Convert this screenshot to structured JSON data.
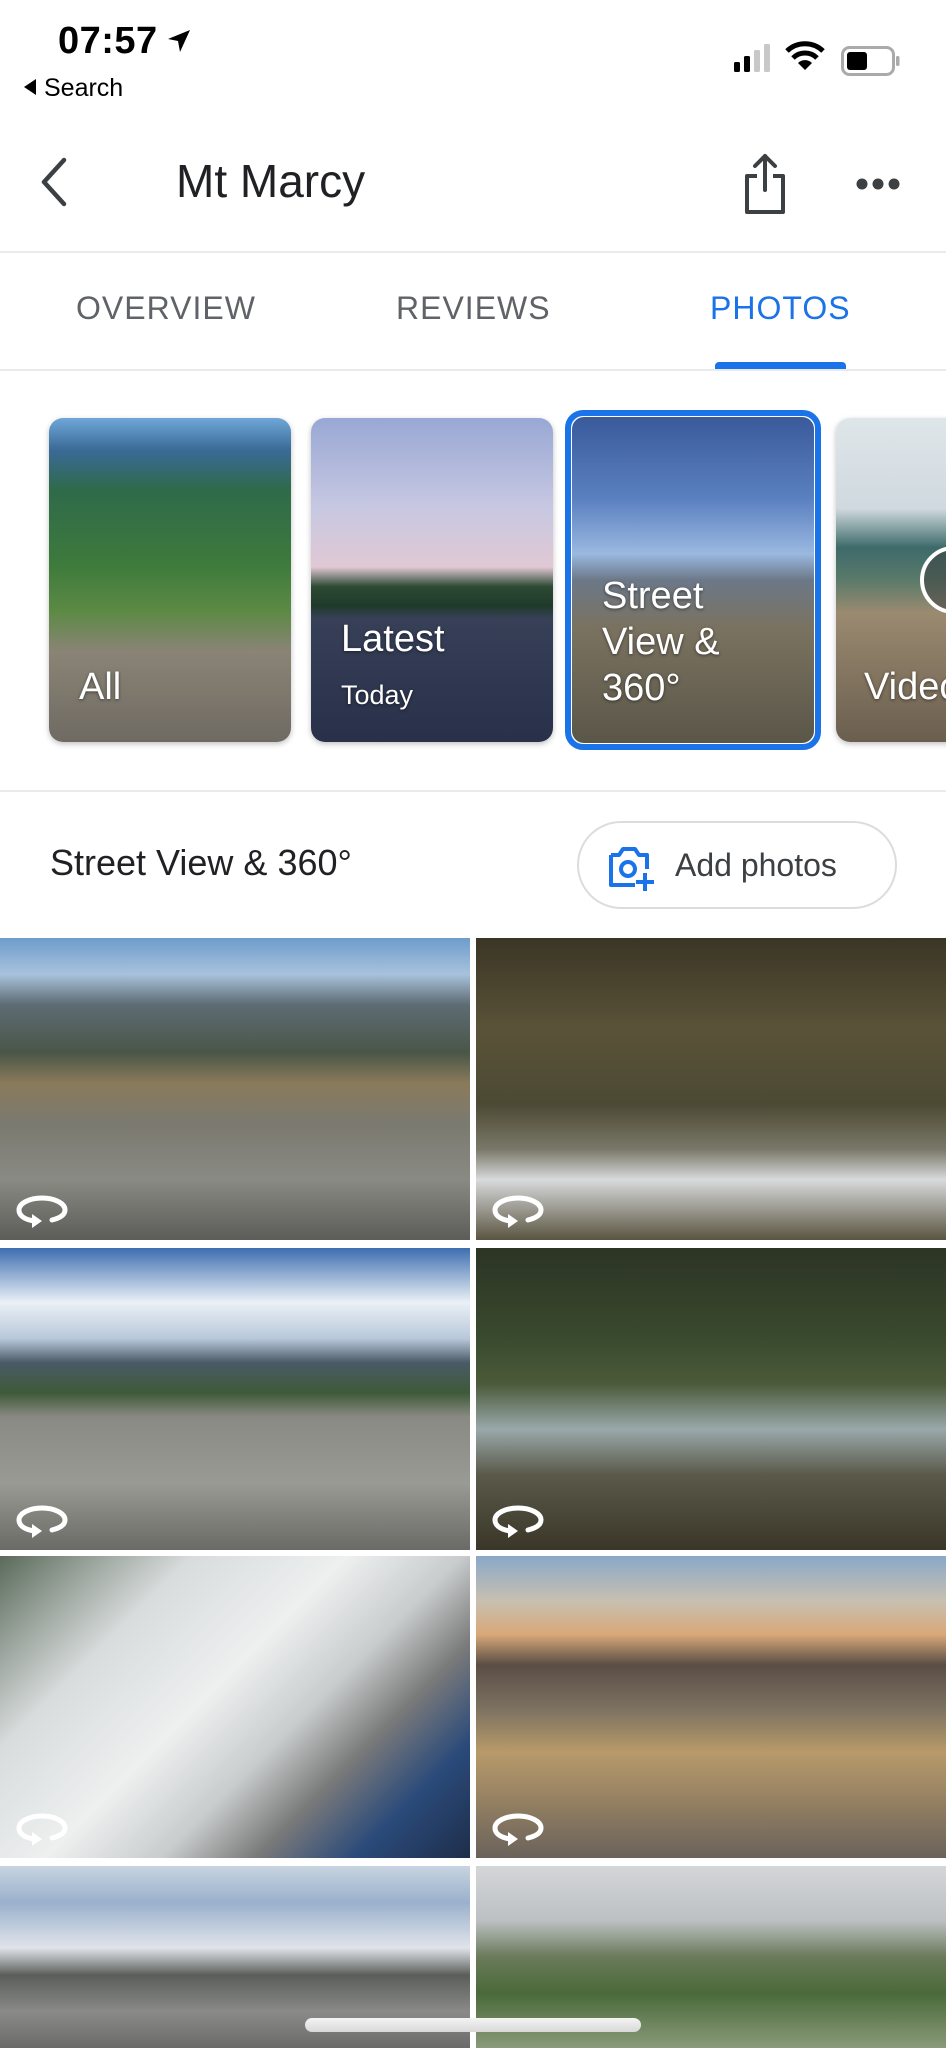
{
  "status_bar": {
    "time": "07:57",
    "back_app_label": "Search",
    "icons": [
      "location-arrow-icon",
      "cellular-signal-icon",
      "wifi-icon",
      "battery-icon"
    ]
  },
  "header": {
    "title": "Mt Marcy",
    "back_icon": "chevron-left-icon",
    "share_icon": "share-icon",
    "more_icon": "more-horizontal-icon"
  },
  "tabs": [
    {
      "label": "OVERVIEW",
      "active": false
    },
    {
      "label": "REVIEWS",
      "active": false
    },
    {
      "label": "PHOTOS",
      "active": true
    }
  ],
  "categories": [
    {
      "label": "All",
      "sub": ""
    },
    {
      "label": "Latest",
      "sub": "Today"
    },
    {
      "label": "Street View & 360°",
      "sub": "",
      "selected": true
    },
    {
      "label": "Videos",
      "sub": ""
    }
  ],
  "section": {
    "title": "Street View & 360°",
    "add_photos_label": "Add photos",
    "add_photos_icon": "add-photo-camera-icon"
  },
  "photos": [
    {
      "desc": "Rocky summit panorama",
      "badge_icon": "360-rotate-icon"
    },
    {
      "desc": "Forest trail with snow",
      "badge_icon": "360-rotate-icon"
    },
    {
      "desc": "Summit rock under blue sky with clouds",
      "badge_icon": "360-rotate-icon"
    },
    {
      "desc": "Mountain stream in forest",
      "badge_icon": "360-rotate-icon"
    },
    {
      "desc": "Snowy rocks from above",
      "badge_icon": "360-rotate-icon"
    },
    {
      "desc": "Sunset over rocky summit",
      "badge_icon": "360-rotate-icon"
    },
    {
      "desc": "Cairn on rocky ridge",
      "badge_icon": null
    },
    {
      "desc": "Cloudy green mountainside",
      "badge_icon": null
    }
  ],
  "colors": {
    "accent": "#1a73e8",
    "tab_inactive": "#5f6368",
    "text": "#202124"
  }
}
